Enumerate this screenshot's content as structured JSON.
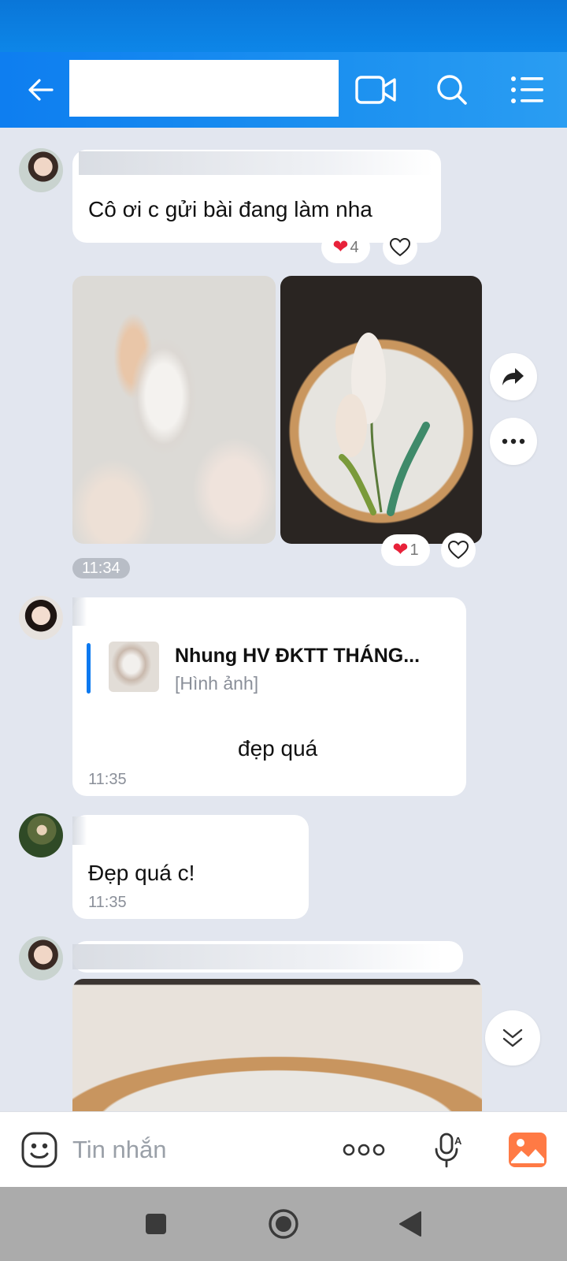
{
  "header": {
    "contact_name": "",
    "back_icon": "arrow-left-icon",
    "video_call_icon": "video-camera-icon",
    "search_icon": "search-icon",
    "menu_icon": "list-menu-icon"
  },
  "messages": [
    {
      "text": "Cô ơi c gửi bài đang làm nha",
      "reaction_count": "4"
    },
    {
      "photo_reaction_count": "1",
      "time": "11:34"
    },
    {
      "quote_name": "Nhung HV ĐKTT THÁNG...",
      "quote_type": "[Hình ảnh]",
      "text": "đẹp quá",
      "time": "11:35"
    },
    {
      "text": "Đẹp quá c!",
      "time": "11:35"
    }
  ],
  "composer": {
    "placeholder": "Tin nhắn",
    "emoji_icon": "emoji-icon",
    "more_icon": "more-dots-icon",
    "voice_icon": "microphone-icon",
    "image_icon": "image-icon"
  },
  "colors": {
    "header": "#0e7ef0",
    "background": "#e2e6ef",
    "heart": "#e8223a",
    "accent": "#0b79f0"
  }
}
